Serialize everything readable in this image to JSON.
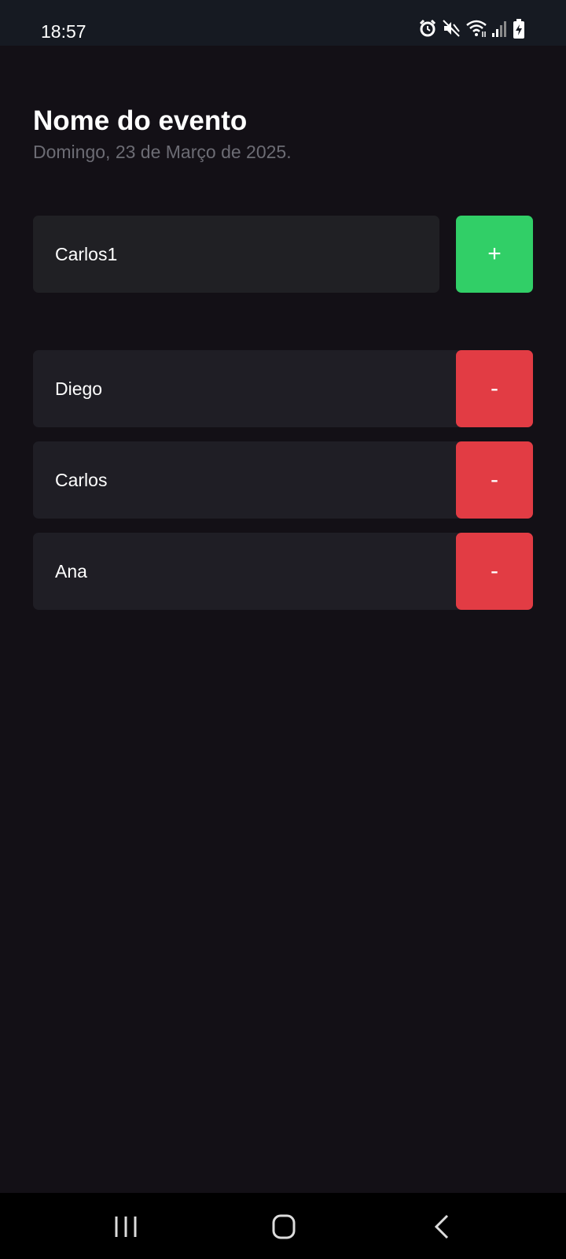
{
  "status_bar": {
    "time": "18:57",
    "icons": [
      "alarm-icon",
      "mute-icon",
      "wifi-icon",
      "signal-icon",
      "battery-charging-icon"
    ]
  },
  "event": {
    "title": "Nome do evento",
    "date": "Domingo, 23 de Março de 2025."
  },
  "new_participant": {
    "value": "Carlos1",
    "add_label": "+"
  },
  "participants": [
    {
      "name": "Diego",
      "remove_label": "-"
    },
    {
      "name": "Carlos",
      "remove_label": "-"
    },
    {
      "name": "Ana",
      "remove_label": "-"
    }
  ],
  "nav_bar": {
    "buttons": [
      "recent-apps-icon",
      "home-icon",
      "back-icon"
    ]
  },
  "colors": {
    "background": "#131016",
    "card": "#1f1e25",
    "add": "#31cf67",
    "remove": "#e23c44",
    "subtitle": "#6c6c74"
  }
}
